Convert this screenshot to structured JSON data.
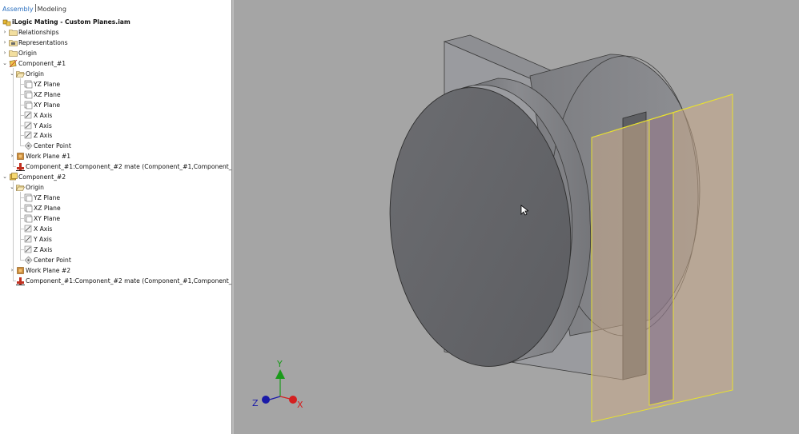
{
  "browser": {
    "tabs": {
      "assembly": "Assembly",
      "modeling": "Modeling"
    },
    "tree": [
      {
        "label": "iLogic Mating - Custom Planes.iam",
        "icon": "assembly-icon",
        "level": 0,
        "bold": true,
        "twisty": ""
      },
      {
        "label": "Relationships",
        "icon": "folder-icon",
        "level": 1,
        "twisty": "›"
      },
      {
        "label": "Representations",
        "icon": "representations-icon",
        "level": 1,
        "twisty": "›"
      },
      {
        "label": "Origin",
        "icon": "folder-icon",
        "level": 1,
        "twisty": "›"
      },
      {
        "label": "Component_#1",
        "icon": "component-icon",
        "level": 1,
        "twisty": "⌄"
      },
      {
        "label": "Origin",
        "icon": "folder-open-icon",
        "level": 2,
        "twisty": "⌄"
      },
      {
        "label": "YZ Plane",
        "icon": "plane-icon",
        "level": 3,
        "twisty": ""
      },
      {
        "label": "XZ Plane",
        "icon": "plane-icon",
        "level": 3,
        "twisty": ""
      },
      {
        "label": "XY Plane",
        "icon": "plane-icon",
        "level": 3,
        "twisty": ""
      },
      {
        "label": "X Axis",
        "icon": "axis-icon",
        "level": 3,
        "twisty": ""
      },
      {
        "label": "Y Axis",
        "icon": "axis-icon",
        "level": 3,
        "twisty": ""
      },
      {
        "label": "Z Axis",
        "icon": "axis-icon",
        "level": 3,
        "twisty": ""
      },
      {
        "label": "Center Point",
        "icon": "point-icon",
        "level": 3,
        "twisty": ""
      },
      {
        "label": "Work Plane #1",
        "icon": "workplane-icon",
        "level": 2,
        "twisty": "›"
      },
      {
        "label": "Component_#1:Component_#2 mate (Component_#1,Component_#2)",
        "icon": "mate-icon",
        "level": 2,
        "twisty": ""
      },
      {
        "label": "Component_#2",
        "icon": "component2-icon",
        "level": 1,
        "twisty": "⌄"
      },
      {
        "label": "Origin",
        "icon": "folder-open-icon",
        "level": 2,
        "twisty": "⌄"
      },
      {
        "label": "YZ Plane",
        "icon": "plane-icon",
        "level": 3,
        "twisty": ""
      },
      {
        "label": "XZ Plane",
        "icon": "plane-icon",
        "level": 3,
        "twisty": ""
      },
      {
        "label": "XY Plane",
        "icon": "plane-icon",
        "level": 3,
        "twisty": ""
      },
      {
        "label": "X Axis",
        "icon": "axis-icon",
        "level": 3,
        "twisty": ""
      },
      {
        "label": "Y Axis",
        "icon": "axis-icon",
        "level": 3,
        "twisty": ""
      },
      {
        "label": "Z Axis",
        "icon": "axis-icon",
        "level": 3,
        "twisty": ""
      },
      {
        "label": "Center Point",
        "icon": "point-icon",
        "level": 3,
        "twisty": ""
      },
      {
        "label": "Work Plane #2",
        "icon": "workplane-icon",
        "level": 2,
        "twisty": "›"
      },
      {
        "label": "Component_#1:Component_#2 mate (Component_#1,Component_#2)",
        "icon": "mate-icon",
        "level": 2,
        "twisty": ""
      }
    ]
  },
  "viewport": {
    "background": "#a5a5a5",
    "work_plane_color": "#e8e030",
    "triad": {
      "x": "X",
      "y": "Y",
      "z": "Z",
      "x_color": "#d42020",
      "y_color": "#1a9a1a",
      "z_color": "#1a1aa8"
    }
  }
}
